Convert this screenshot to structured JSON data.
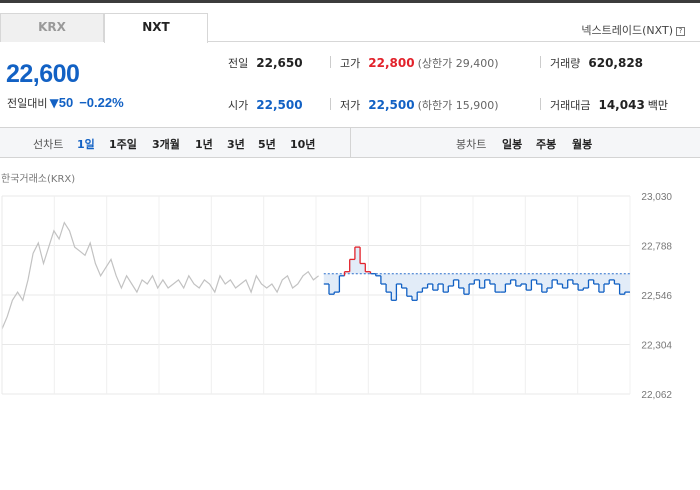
{
  "tabs": [
    {
      "label": "KRX",
      "active": false
    },
    {
      "label": "NXT",
      "active": true
    }
  ],
  "market_link": "넥스트레이드(NXT)",
  "help_glyph": "?",
  "price": {
    "current": "22,600",
    "change_label": "전일대비",
    "change_arrow": "▼",
    "change_value": "50",
    "change_pct": "−0.22%"
  },
  "stats": {
    "prev_label": "전일",
    "prev_value": "22,650",
    "high_label": "고가",
    "high_value": "22,800",
    "upper_limit": "(상한가 29,400)",
    "volume_label": "거래량",
    "volume_value": "620,828",
    "open_label": "시가",
    "open_value": "22,500",
    "low_label": "저가",
    "low_value": "22,500",
    "lower_limit": "(하한가 15,900)",
    "amount_label": "거래대금",
    "amount_value": "14,043",
    "amount_unit": "백만"
  },
  "period": {
    "line_label": "선차트",
    "line_items": [
      "1일",
      "1주일",
      "3개월",
      "1년",
      "3년",
      "5년",
      "10년"
    ],
    "active": "1일",
    "candle_label": "봉차트",
    "candle_items": [
      "일봉",
      "주봉",
      "월봉"
    ]
  },
  "colors": {
    "up": "#e2222b",
    "down": "#1261c4",
    "pre": "#c2c2c2",
    "price_blue": "#1261c4"
  },
  "chart_data": {
    "type": "line",
    "title": "한국거래소(KRX)",
    "ylim": [
      22062,
      23030
    ],
    "yticks": [
      "23,030",
      "22,788",
      "22,546",
      "22,304",
      "22,062"
    ],
    "ytick_values": [
      23030,
      22788,
      22546,
      22304,
      22062
    ],
    "reference_price": 22650,
    "grid": true,
    "series": [
      {
        "name": "",
        "segment": "pre-market",
        "color": "#c2c2c2",
        "values": [
          22380,
          22440,
          22520,
          22560,
          22520,
          22620,
          22750,
          22800,
          22700,
          22780,
          22860,
          22820,
          22900,
          22860,
          22780,
          22760,
          22740,
          22800,
          22700,
          22640,
          22680,
          22720,
          22640,
          22580,
          22640,
          22600,
          22560,
          22620,
          22600,
          22640,
          22580,
          22620,
          22580,
          22600,
          22620,
          22580,
          22640,
          22600,
          22580,
          22620,
          22600,
          22560,
          22640,
          22600,
          22620,
          22580,
          22600,
          22620,
          22560,
          22640,
          22600,
          22580,
          22600,
          22560,
          22620,
          22640,
          22580,
          22600,
          22640,
          22660,
          22620,
          22640
        ]
      },
      {
        "name": "",
        "segment": "regular",
        "color": "#1261c4",
        "values": [
          22600,
          22550,
          22560,
          22640,
          22660,
          22720,
          22780,
          22700,
          22660,
          22650,
          22640,
          22600,
          22560,
          22520,
          22600,
          22580,
          22540,
          22520,
          22560,
          22580,
          22600,
          22570,
          22600,
          22560,
          22590,
          22620,
          22580,
          22550,
          22600,
          22620,
          22580,
          22620,
          22600,
          22560,
          22560,
          22600,
          22620,
          22590,
          22600,
          22570,
          22620,
          22600,
          22560,
          22580,
          22620,
          22600,
          22580,
          22620,
          22600,
          22570,
          22580,
          22620,
          22600,
          22560,
          22600,
          22620,
          22600,
          22550,
          22560
        ]
      }
    ]
  }
}
